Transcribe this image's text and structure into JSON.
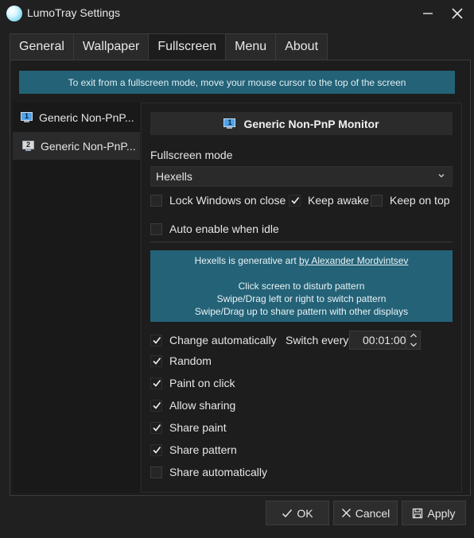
{
  "window": {
    "title": "LumoTray Settings"
  },
  "tabs": [
    {
      "label": "General"
    },
    {
      "label": "Wallpaper"
    },
    {
      "label": "Fullscreen"
    },
    {
      "label": "Menu"
    },
    {
      "label": "About"
    }
  ],
  "active_tab": "Fullscreen",
  "info_banner": "To exit from a fullscreen mode, move your mouse cursor to the top of the screen",
  "monitors": [
    {
      "number": "1",
      "label": "Generic Non-PnP..."
    },
    {
      "number": "2",
      "label": "Generic Non-PnP..."
    }
  ],
  "selected_monitor": {
    "number": "1",
    "title": "Generic Non-PnP Monitor"
  },
  "fullscreen_mode": {
    "label": "Fullscreen mode",
    "value": "Hexells"
  },
  "options": {
    "lock_windows_on_close": {
      "label": "Lock Windows on close",
      "checked": false
    },
    "keep_awake": {
      "label": "Keep awake",
      "checked": true
    },
    "keep_on_top": {
      "label": "Keep on top",
      "checked": false
    },
    "auto_enable_when_idle": {
      "label": "Auto enable when idle",
      "checked": false
    }
  },
  "art_info": {
    "prefix": "Hexells is generative art ",
    "author_link": "by Alexander Mordvintsev",
    "line1": "Click screen to disturb pattern",
    "line2": "Swipe/Drag left or right to switch pattern",
    "line3": "Swipe/Drag up to share pattern with other displays"
  },
  "hexells_options": {
    "change_automatically": {
      "label": "Change automatically",
      "checked": true
    },
    "switch_every": {
      "label": "Switch every",
      "value": "00:01:00"
    },
    "random": {
      "label": "Random",
      "checked": true
    },
    "paint_on_click": {
      "label": "Paint on click",
      "checked": true
    },
    "allow_sharing": {
      "label": "Allow sharing",
      "checked": true
    },
    "share_paint": {
      "label": "Share paint",
      "checked": true
    },
    "share_pattern": {
      "label": "Share pattern",
      "checked": true
    },
    "share_automatically": {
      "label": "Share automatically",
      "checked": false
    }
  },
  "buttons": {
    "ok": "OK",
    "cancel": "Cancel",
    "apply": "Apply"
  },
  "colors": {
    "accent_banner": "#246277",
    "background": "#202020",
    "monitor_icon": "#4fa3e8"
  }
}
